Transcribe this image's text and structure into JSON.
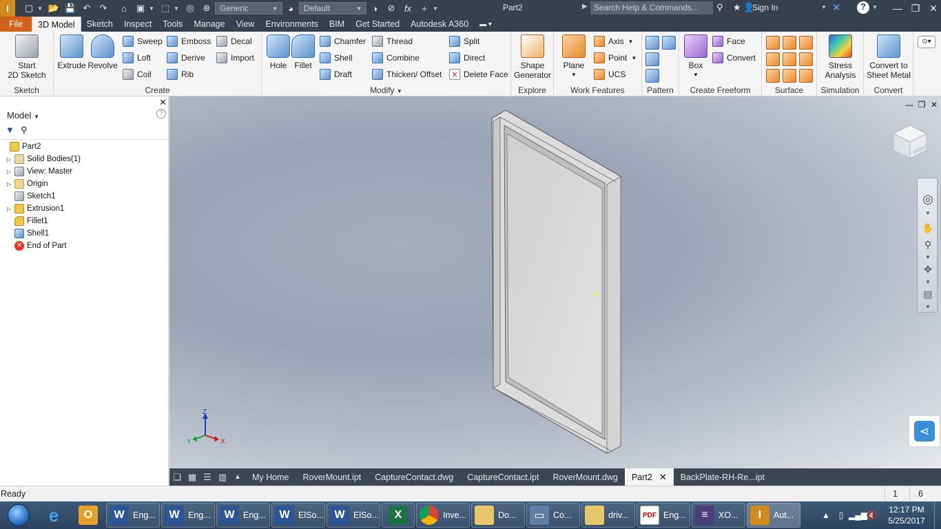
{
  "titlebar": {
    "title": "Part2",
    "material": "Generic",
    "appearance": "Default",
    "search_placeholder": "Search Help & Commands...",
    "sign_in": "Sign In",
    "fx": "fx"
  },
  "tabs": [
    "File",
    "3D Model",
    "Sketch",
    "Inspect",
    "Tools",
    "Manage",
    "View",
    "Environments",
    "BIM",
    "Get Started",
    "Autodesk A360"
  ],
  "ribbon": {
    "sketch": {
      "label": "Sketch",
      "start_line1": "Start",
      "start_line2": "2D Sketch"
    },
    "create": {
      "label": "Create",
      "extrude": "Extrude",
      "revolve": "Revolve",
      "sweep": "Sweep",
      "loft": "Loft",
      "coil": "Coil",
      "emboss": "Emboss",
      "derive": "Derive",
      "rib": "Rib",
      "decal": "Decal",
      "import": "Import"
    },
    "modify": {
      "label": "Modify",
      "hole": "Hole",
      "fillet": "Fillet",
      "chamfer": "Chamfer",
      "shell": "Shell",
      "draft": "Draft",
      "thread": "Thread",
      "combine": "Combine",
      "thicken": "Thicken/ Offset",
      "split": "Split",
      "direct": "Direct",
      "delete_face": "Delete Face"
    },
    "explore": {
      "label": "Explore",
      "shape_line1": "Shape",
      "shape_line2": "Generator"
    },
    "work_features": {
      "label": "Work Features",
      "plane": "Plane",
      "axis": "Axis",
      "point": "Point",
      "ucs": "UCS"
    },
    "pattern": {
      "label": "Pattern"
    },
    "freeform": {
      "label": "Create Freeform",
      "box": "Box",
      "face": "Face",
      "convert": "Convert"
    },
    "surface": {
      "label": "Surface"
    },
    "simulation": {
      "label": "Simulation",
      "stress_line1": "Stress",
      "stress_line2": "Analysis"
    },
    "convert": {
      "label": "Convert",
      "line1": "Convert to",
      "line2": "Sheet Metal"
    }
  },
  "browser": {
    "title": "Model",
    "help": "?",
    "tree": [
      "Part2",
      "Solid Bodies(1)",
      "View: Master",
      "Origin",
      "Sketch1",
      "Extrusion1",
      "Fillet1",
      "Shell1",
      "End of Part"
    ]
  },
  "viewport": {
    "axis_x": "X",
    "axis_y": "Y",
    "axis_z": "Z",
    "cube_face": "FRONT"
  },
  "doc_tabs": [
    "My Home",
    "RoverMount.ipt",
    "CaptureContact.dwg",
    "CaptureContact.ipt",
    "RoverMount.dwg",
    "Part2",
    "BackPlate-RH-Re...ipt"
  ],
  "doc_tab_active": "Part2",
  "status": {
    "text": "Ready",
    "num1": "1",
    "num2": "6"
  },
  "taskbar": {
    "items": [
      {
        "label": "Eng...",
        "icon": "word-icon"
      },
      {
        "label": "Eng...",
        "icon": "word-icon"
      },
      {
        "label": "Eng...",
        "icon": "word-icon"
      },
      {
        "label": "ElSo...",
        "icon": "word-icon"
      },
      {
        "label": "ElSo...",
        "icon": "word-icon"
      },
      {
        "label": "",
        "icon": "excel-icon"
      },
      {
        "label": "Inve...",
        "icon": "chrome-icon"
      },
      {
        "label": "Do...",
        "icon": "folder-icon"
      },
      {
        "label": "Co...",
        "icon": "computer-icon"
      },
      {
        "label": "driv...",
        "icon": "folder-icon"
      },
      {
        "label": "Eng...",
        "icon": "pdf-icon"
      },
      {
        "label": "XO...",
        "icon": "xo-icon"
      },
      {
        "label": "Aut...",
        "icon": "inventor-icon"
      }
    ],
    "time": "12:17 PM",
    "date": "5/25/2017"
  }
}
